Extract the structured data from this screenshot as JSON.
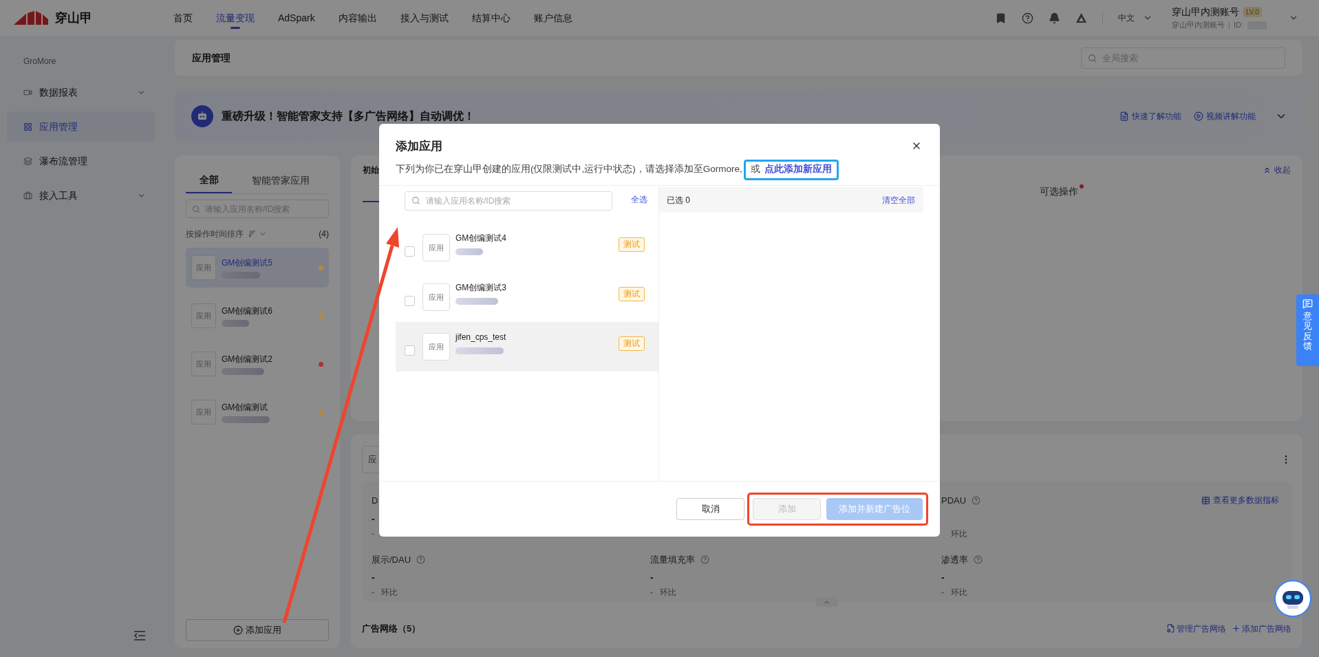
{
  "top_bar": {
    "logo": "穿山甲",
    "nav": [
      {
        "label": "首页",
        "selected": false
      },
      {
        "label": "流量变现",
        "selected": true
      },
      {
        "label": "AdSpark",
        "selected": false
      },
      {
        "label": "内容输出",
        "selected": false
      },
      {
        "label": "接入与测试",
        "selected": false
      },
      {
        "label": "结算中心",
        "selected": false
      },
      {
        "label": "账户信息",
        "selected": false
      }
    ],
    "language": "中文",
    "account": {
      "name": "穿山甲内测账号",
      "level": "LV.0",
      "sub": "穿山甲内测账号",
      "id_label": "ID:"
    }
  },
  "sidebar": {
    "section": "GroMore",
    "items": [
      {
        "label": "数据报表",
        "selected": false,
        "expandable": true
      },
      {
        "label": "应用管理",
        "selected": true,
        "expandable": false
      },
      {
        "label": "瀑布流管理",
        "selected": false,
        "expandable": false
      },
      {
        "label": "接入工具",
        "selected": false,
        "expandable": true
      }
    ]
  },
  "page_header": {
    "title": "应用管理",
    "search": {
      "placeholder": "全局搜索"
    }
  },
  "banner": {
    "text": "重磅升级！智能管家支持【多广告网络】自动调优！",
    "links": [
      "快速了解功能",
      "视频讲解功能"
    ]
  },
  "app_panel": {
    "tabs": [
      {
        "label": "全部",
        "selected": true
      },
      {
        "label": "智能管家应用",
        "selected": false
      }
    ],
    "search": {
      "placeholder": "请输入应用名称/ID搜索"
    },
    "sort_label": "按操作时间排序",
    "count": "(4)",
    "apps": [
      {
        "icon": "应用",
        "name": "GM创编测试5",
        "selected": true,
        "color": "#b8893a"
      },
      {
        "icon": "应用",
        "name": "GM创编测试6",
        "selected": false,
        "color": "#b8893a"
      },
      {
        "icon": "应用",
        "name": "GM创编测试2",
        "selected": false,
        "color": "#b23030"
      },
      {
        "icon": "应用",
        "name": "GM创编测试",
        "selected": false,
        "color": "#b8893a"
      }
    ],
    "add_button": "添加应用"
  },
  "detail_panel": {
    "tab": "初始",
    "optional": {
      "label": "可选操作",
      "badge_dot": true
    },
    "collapse": "收起"
  },
  "metrics_panel": {
    "field": "应",
    "rows": [
      [
        {
          "label": "D",
          "help": false,
          "value": "-",
          "delta": "-"
        },
        null,
        {
          "label": "PDAU",
          "help": true,
          "delta_label": "环比"
        }
      ],
      [
        {
          "label": "展示/DAU",
          "help": true,
          "value": "-",
          "delta": "-",
          "delta_label": "环比"
        },
        {
          "label": "流量填充率",
          "help": true,
          "value": "-",
          "delta": "-",
          "delta_label": "环比"
        },
        {
          "label": "渗透率",
          "help": true,
          "value": "-",
          "delta": "-",
          "delta_label": "环比"
        }
      ]
    ],
    "more_link": "查看更多数据指标",
    "expanded": true,
    "networks": {
      "title": "广告网络（5）",
      "links": [
        "管理广告网络",
        "添加广告网络"
      ]
    }
  },
  "modal": {
    "title": "添加应用",
    "description": "下列为你已在穿山甲创建的应用(仅限测试中,运行中状态)，请选择添加至Gormore,",
    "or": "或",
    "add_new_link": "点此添加新应用",
    "search": {
      "placeholder": "请输入应用名称/ID搜索"
    },
    "select_all": "全选",
    "apps": [
      {
        "icon": "应用",
        "name": "GM创编测试4",
        "tag": "测试",
        "checked": false,
        "hovered": false
      },
      {
        "icon": "应用",
        "name": "GM创编测试3",
        "tag": "测试",
        "checked": false,
        "hovered": false
      },
      {
        "icon": "应用",
        "name": "jifen_cps_test",
        "tag": "测试",
        "checked": false,
        "hovered": true
      }
    ],
    "selected_label": "已选 0",
    "clear_all": "清空全部",
    "buttons": [
      {
        "label": "取消",
        "kind": "default",
        "disabled": false
      },
      {
        "label": "添加",
        "kind": "default",
        "disabled": true
      },
      {
        "label": "添加并新建广告位",
        "kind": "primary",
        "disabled": true
      }
    ]
  },
  "feedback": "意见反馈"
}
